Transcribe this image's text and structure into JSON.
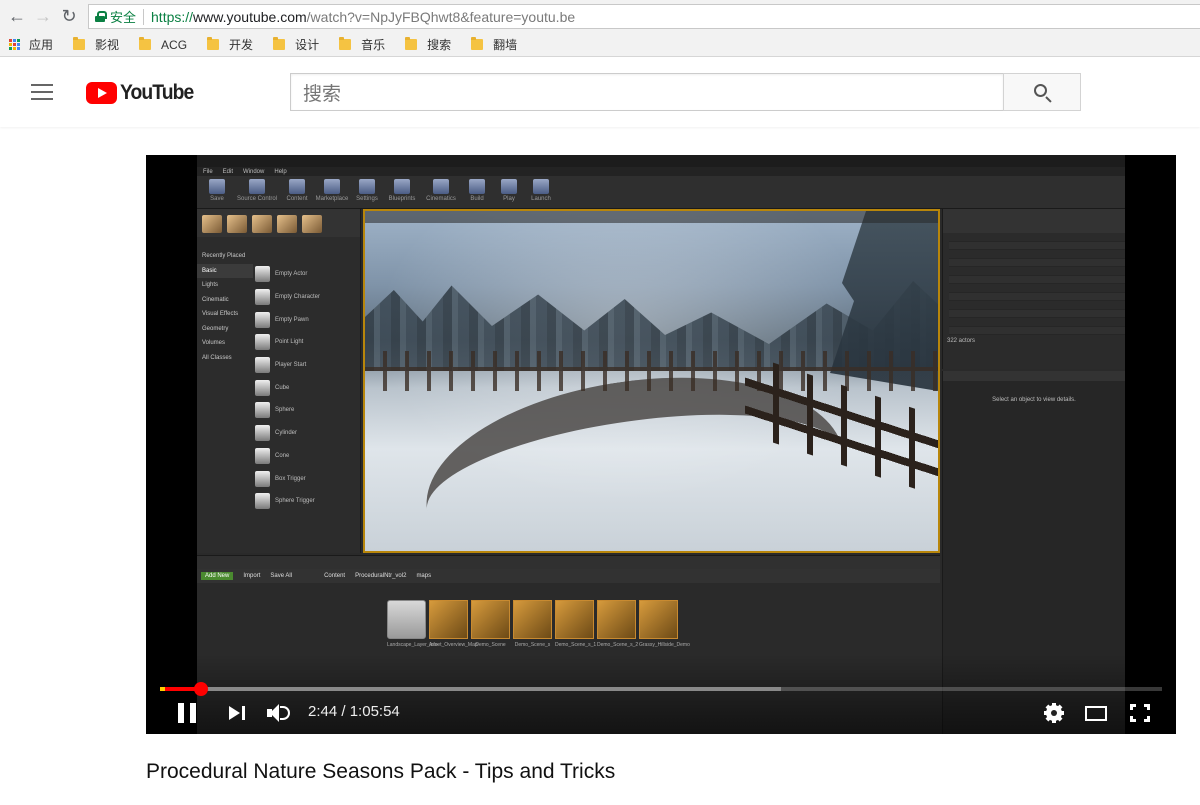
{
  "browser": {
    "secure_label": "安全",
    "url_scheme": "https://",
    "url_host": "www.youtube.com",
    "url_rest": "/watch?v=NpJyFBQhwt8&feature=youtu.be",
    "bookmarks": [
      "应用",
      "影视",
      "ACG",
      "开发",
      "设计",
      "音乐",
      "搜索",
      "翻墙"
    ]
  },
  "youtube": {
    "logo_text": "YouTube",
    "search_placeholder": "搜索"
  },
  "player": {
    "current_time": "2:44",
    "duration": "1:05:54",
    "time_display": "2:44 / 1:05:54",
    "played_fraction": 0.041,
    "buffered_fraction": 0.62,
    "accent_color": "#ff0000"
  },
  "unreal_editor": {
    "menu": [
      "File",
      "Edit",
      "Window",
      "Help"
    ],
    "toolbar": [
      "Save",
      "Source Control",
      "Content",
      "Marketplace",
      "Settings",
      "Blueprints",
      "Cinematics",
      "Build",
      "Play",
      "Launch"
    ],
    "mode_categories": [
      "Recently Placed",
      "Basic",
      "Lights",
      "Cinematic",
      "Visual Effects",
      "Geometry",
      "Volumes",
      "All Classes"
    ],
    "placeable_items": [
      "Empty Actor",
      "Empty Character",
      "Empty Pawn",
      "Point Light",
      "Player Start",
      "Cube",
      "Sphere",
      "Cylinder",
      "Cone",
      "Box Trigger",
      "Sphere Trigger"
    ],
    "content_browser": {
      "add_new": "Add New",
      "import": "Import",
      "save_all": "Save All",
      "path": [
        "Content",
        "ProceduralNtr_vol2",
        "maps"
      ],
      "assets": [
        "Landscape_Layer_info",
        "Asset_Overview_Map",
        "Demo_Scene",
        "Demo_Scene_s",
        "Demo_Scene_s_1",
        "Demo_Scene_s_2",
        "Grassy_Hillside_Demo"
      ]
    },
    "details_hint": "Select an object to view details.",
    "actors_count": "322 actors"
  },
  "video": {
    "title": "Procedural Nature Seasons Pack - Tips and Tricks"
  }
}
